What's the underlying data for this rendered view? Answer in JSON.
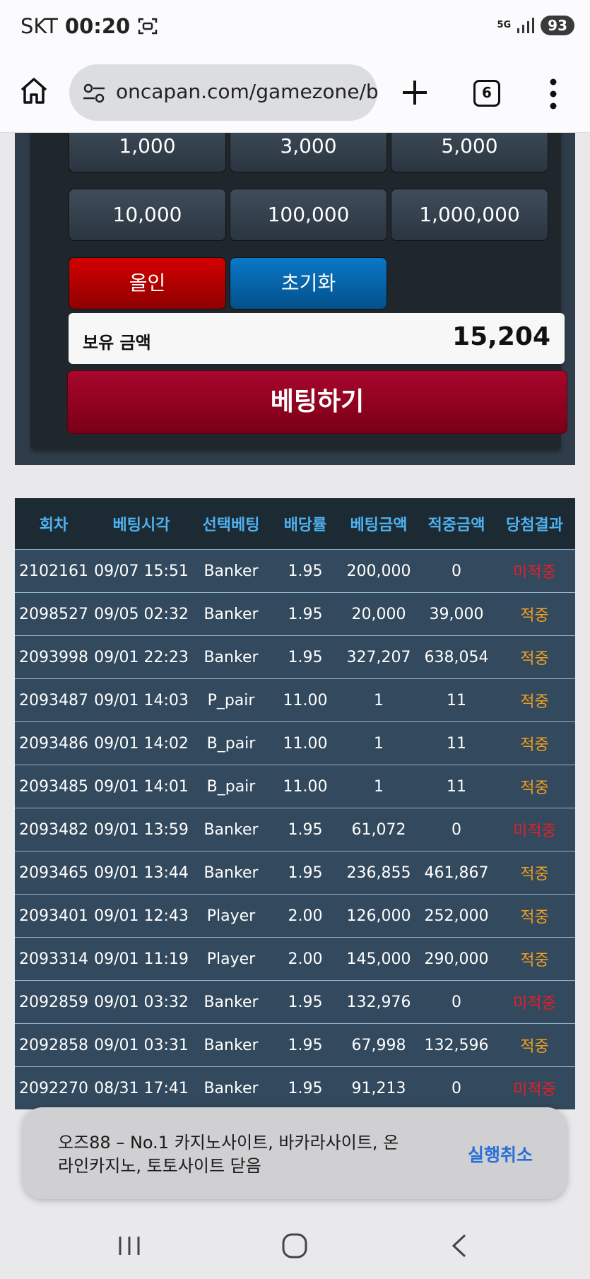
{
  "status_bar": {
    "carrier": "SKT",
    "time": "00:20",
    "network": "5G",
    "battery": "93"
  },
  "browser": {
    "url": "oncapan.com/gamezone/ba",
    "tab_count": "6"
  },
  "bet_panel": {
    "amounts": [
      "1,000",
      "3,000",
      "5,000",
      "10,000",
      "100,000",
      "1,000,000"
    ],
    "allin_label": "올인",
    "reset_label": "초기화",
    "balance_label": "보유 금액",
    "balance_value": "15,204",
    "submit_label": "베팅하기"
  },
  "history": {
    "headers": [
      "회차",
      "베팅시각",
      "선택베팅",
      "배당률",
      "베팅금액",
      "적중금액",
      "당첨결과"
    ],
    "rows": [
      [
        "2102161",
        "09/07 15:51",
        "Banker",
        "1.95",
        "200,000",
        "0",
        "미적중"
      ],
      [
        "2098527",
        "09/05 02:32",
        "Banker",
        "1.95",
        "20,000",
        "39,000",
        "적중"
      ],
      [
        "2093998",
        "09/01 22:23",
        "Banker",
        "1.95",
        "327,207",
        "638,054",
        "적중"
      ],
      [
        "2093487",
        "09/01 14:03",
        "P_pair",
        "11.00",
        "1",
        "11",
        "적중"
      ],
      [
        "2093486",
        "09/01 14:02",
        "B_pair",
        "11.00",
        "1",
        "11",
        "적중"
      ],
      [
        "2093485",
        "09/01 14:01",
        "B_pair",
        "11.00",
        "1",
        "11",
        "적중"
      ],
      [
        "2093482",
        "09/01 13:59",
        "Banker",
        "1.95",
        "61,072",
        "0",
        "미적중"
      ],
      [
        "2093465",
        "09/01 13:44",
        "Banker",
        "1.95",
        "236,855",
        "461,867",
        "적중"
      ],
      [
        "2093401",
        "09/01 12:43",
        "Player",
        "2.00",
        "126,000",
        "252,000",
        "적중"
      ],
      [
        "2093314",
        "09/01 11:19",
        "Player",
        "2.00",
        "145,000",
        "290,000",
        "적중"
      ],
      [
        "2092859",
        "09/01 03:32",
        "Banker",
        "1.95",
        "132,976",
        "0",
        "미적중"
      ],
      [
        "2092858",
        "09/01 03:31",
        "Banker",
        "1.95",
        "67,998",
        "132,596",
        "적중"
      ],
      [
        "2092270",
        "08/31 17:41",
        "Banker",
        "1.95",
        "91,213",
        "0",
        "미적중"
      ]
    ]
  },
  "toast": {
    "message": "오즈88 – No.1 카지노사이트, 바카라사이트, 온라인카지노, 토토사이트 닫음",
    "action": "실행취소"
  },
  "colors": {
    "win": "#f0a020",
    "lose": "#e0202a",
    "header_text": "#4fb1ee",
    "submit": "#a8062c"
  },
  "icons": [
    "home-icon",
    "site-settings-icon",
    "new-tab-icon",
    "tab-switcher-icon",
    "more-menu-icon",
    "recents-icon",
    "home-nav-icon",
    "back-icon"
  ]
}
